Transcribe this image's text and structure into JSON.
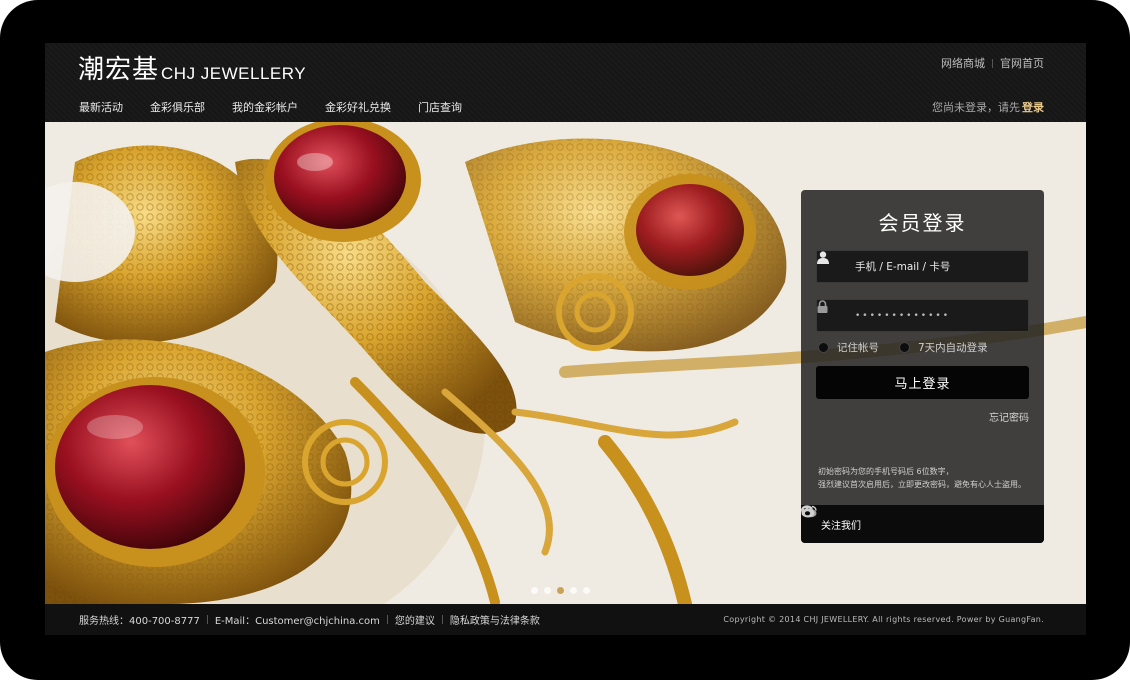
{
  "header": {
    "logo_cn": "潮宏基",
    "logo_en": "CHJ JEWELLERY",
    "top_links": [
      "网络商城",
      "官网首页"
    ],
    "nav": [
      "最新活动",
      "金彩俱乐部",
      "我的金彩帐户",
      "金彩好礼兑换",
      "门店查询"
    ],
    "login_hint": "您尚未登录，请先",
    "login_link": "登录"
  },
  "banner": {
    "slides": 5,
    "active_slide": 3
  },
  "login_panel": {
    "title": "会员登录",
    "username_placeholder": "手机 / E-mail / 卡号",
    "password_mask": "•••••••••••••",
    "remember_account": "记住帐号",
    "auto_login": "7天内自动登录",
    "submit": "马上登录",
    "forgot": "忘记密码",
    "notice_line1": "初始密码为您的手机号码后 6位数字，",
    "notice_line2": "强烈建议首次启用后，立即更改密码，避免有心人士盗用。",
    "follow_label": "关注我们"
  },
  "footer": {
    "hotline": "服务热线：400-700-8777",
    "email": "E-Mail：Customer@chjchina.com",
    "feedback": "您的建议",
    "privacy": "隐私政策与法律条款",
    "copyright": "Copyright © 2014 CHJ JEWELLERY. All rights reserved. Power by GuangFan."
  },
  "colors": {
    "accent_gold": "#e8c98a",
    "background_dark": "#161616"
  },
  "icons": [
    "user-icon",
    "lock-icon",
    "wechat-icon",
    "weibo-icon"
  ]
}
